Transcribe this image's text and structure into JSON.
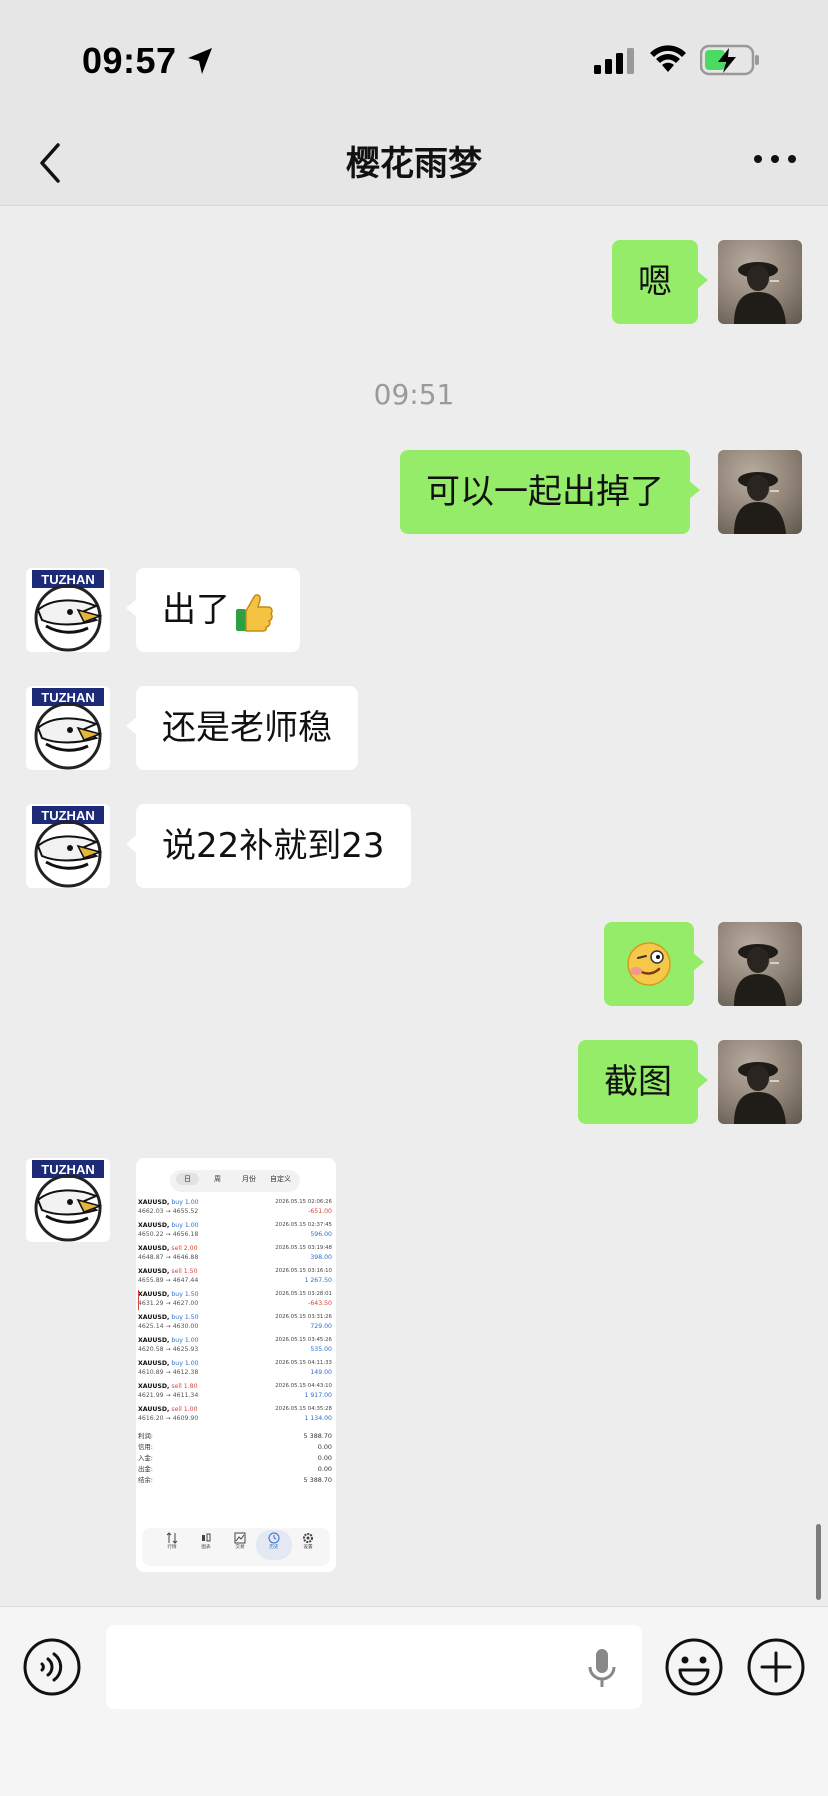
{
  "status_bar": {
    "time": "09:57"
  },
  "header": {
    "title": "樱花雨梦"
  },
  "messages": [
    {
      "side": "out",
      "text": "嗯"
    },
    {
      "side": "out",
      "text": "可以一起出掉了"
    },
    {
      "side": "in",
      "text": "出了",
      "sender": "TUZHAN"
    },
    {
      "side": "in",
      "text": "还是老师稳",
      "sender": "TUZHAN"
    },
    {
      "side": "in",
      "text": "说22补就到23",
      "sender": "TUZHAN"
    },
    {
      "side": "out",
      "text": "",
      "emoji": "smirk-emoji"
    },
    {
      "side": "out",
      "text": "截图"
    }
  ],
  "timestamp": "09:51",
  "avatar_label": "TUZHAN",
  "screenshot": {
    "tabs": [
      "日",
      "周",
      "月份",
      "自定义"
    ],
    "trades": [
      {
        "symbol": "XAUUSD,",
        "side": "buy",
        "label": "buy 1.00",
        "prices": "4662.03 → 4655.52",
        "date": "2026.05.15 02:06:26",
        "profit": "-651.00"
      },
      {
        "symbol": "XAUUSD,",
        "side": "buy",
        "label": "buy 1.00",
        "prices": "4650.22 → 4656.18",
        "date": "2026.05.15 02:37:45",
        "profit": "596.00"
      },
      {
        "symbol": "XAUUSD,",
        "side": "sell",
        "label": "sell 2.00",
        "prices": "4648.87 → 4646.88",
        "date": "2026.05.15 03:19:48",
        "profit": "398.00"
      },
      {
        "symbol": "XAUUSD,",
        "side": "sell",
        "label": "sell 1.50",
        "prices": "4655.89 → 4647.44",
        "date": "2026.05.15 03:16:10",
        "profit": "1 267.50"
      },
      {
        "symbol": "XAUUSD,",
        "side": "buy",
        "label": "buy 1.50",
        "prices": "4631.29 → 4627.00",
        "date": "2026.05.15 03:28:01",
        "profit": "-643.50"
      },
      {
        "symbol": "XAUUSD,",
        "side": "buy",
        "label": "buy 1.50",
        "prices": "4625.14 → 4630.00",
        "date": "2026.05.15 03:31:26",
        "profit": "729.00"
      },
      {
        "symbol": "XAUUSD,",
        "side": "buy",
        "label": "buy 1.00",
        "prices": "4620.58 → 4625.93",
        "date": "2026.05.15 03:45:26",
        "profit": "535.00"
      },
      {
        "symbol": "XAUUSD,",
        "side": "buy",
        "label": "buy 1.00",
        "prices": "4610.89 → 4612.38",
        "date": "2026.05.15 04:11:33",
        "profit": "149.00"
      },
      {
        "symbol": "XAUUSD,",
        "side": "sell",
        "label": "sell 1.80",
        "prices": "4621.99 → 4611.34",
        "date": "2026.05.15 04:43:10",
        "profit": "1 917.00"
      },
      {
        "symbol": "XAUUSD,",
        "side": "sell",
        "label": "sell 1.00",
        "prices": "4616.20 → 4609.90",
        "date": "2026.05.15 04:35:28",
        "profit": "1 134.00"
      }
    ],
    "summary": [
      {
        "label": "利润:",
        "value": "5 388.70"
      },
      {
        "label": "信用:",
        "value": "0.00"
      },
      {
        "label": "入金:",
        "value": "0.00"
      },
      {
        "label": "出金:",
        "value": "0.00"
      },
      {
        "label": "结余:",
        "value": "5 388.70"
      }
    ],
    "nav": [
      "行情",
      "图表",
      "交易",
      "历史",
      "设置"
    ]
  },
  "input": {
    "placeholder": ""
  },
  "colors": {
    "outgoing_bubble": "#95ec69",
    "incoming_bubble": "#ffffff",
    "background": "#ededed",
    "buy": "#2f6fd3",
    "sell": "#d9443a"
  }
}
